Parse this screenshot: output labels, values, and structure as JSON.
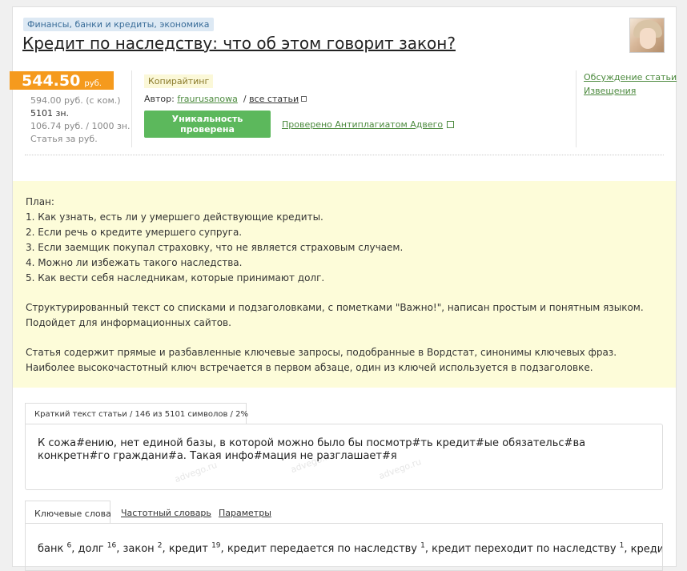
{
  "article": {
    "category": "Финансы, банки и кредиты, экономика",
    "title": "Кредит по наследству: что об этом говорит закон?"
  },
  "price": {
    "value": "544.50",
    "currency": "руб.",
    "with_commission": "594.00 руб. (с ком.)",
    "chars": "5101 зн.",
    "per_1000": "106.74 руб. / 1000 зн.",
    "more": "Статья за руб."
  },
  "meta": {
    "tag": "Копирайтинг",
    "author_label": "Автор:",
    "author_name": "fraurusanowa",
    "all_articles": "все статьи",
    "unique_button": "Уникальность проверена",
    "antiplagiat": "Проверено Антиплагиатом Адвего"
  },
  "side_links": {
    "discussion": "Обсуждение статьи",
    "notices": "Извещения"
  },
  "description": {
    "plan_title": "План:",
    "plan_items": [
      "1. Как узнать, есть ли у умершего действующие кредиты.",
      "2. Если речь о кредите умершего супруга.",
      "3. Если заемщик покупал страховку, что не является страховым случаем.",
      "4. Можно ли избежать такого наследства.",
      "5. Как вести себя наследникам, которые принимают долг."
    ],
    "para1": "Структурированный текст со списками и подзаголовками, с пометками \"Важно!\", написан простым и понятным языком. Подойдет для информационных сайтов.",
    "para2": "Статья содержит прямые и разбавленные ключевые запросы, подобранные в Вордстат, синонимы ключевых фраз. Наиболее высокочастотный ключ встречается в первом абзаце, один из ключей используется в подзаголовке."
  },
  "excerpt": {
    "tab_label": "Краткий текст статьи / 146 из 5101 символов / 2%",
    "text": "К сожа#ению, нет единой базы, в которой можно было бы посмотр#ть кредит#ые обязательс#ва конкретн#го граждани#а. Такая инфо#мация не разглашает#я",
    "watermark": "advego.ru"
  },
  "tabs": {
    "keywords": "Ключевые слова",
    "frequency": "Частотный словарь",
    "params": "Параметры"
  },
  "keywords": [
    {
      "word": "банк",
      "count": "6"
    },
    {
      "word": "долг",
      "count": "16"
    },
    {
      "word": "закон",
      "count": "2"
    },
    {
      "word": "кредит",
      "count": "19"
    },
    {
      "word": "кредит передается по наследству",
      "count": "1"
    },
    {
      "word": "кредит переходит по наследству",
      "count": "1"
    },
    {
      "word": "кредит по",
      "count": ""
    }
  ]
}
